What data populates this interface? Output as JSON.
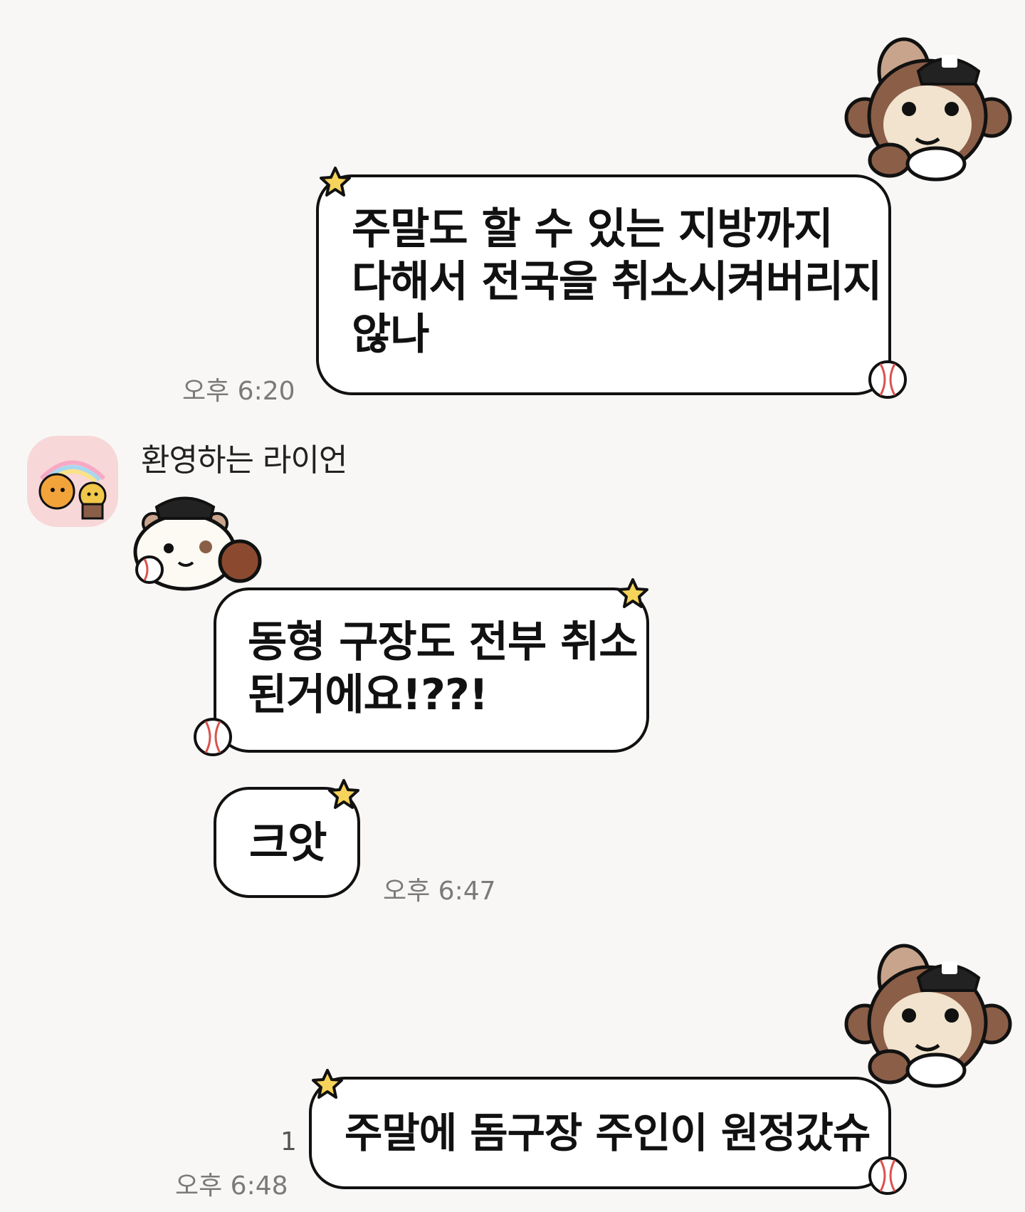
{
  "messages": [
    {
      "direction": "outgoing",
      "text": "주말도 할 수 있는 지방까지\n다해서 전국을 취소시켜버리지\n않나",
      "time": "오후 6:20"
    },
    {
      "direction": "incoming",
      "sender": "환영하는 라이언",
      "text": "동형 구장도 전부 취소\n된거에요!??!"
    },
    {
      "direction": "incoming",
      "text": "크앗",
      "time": "오후 6:47"
    },
    {
      "direction": "outgoing",
      "text": "주말에 돔구장 주인이 원정갔슈",
      "time": "오후 6:48",
      "unread_count": "1"
    }
  ],
  "icons": {
    "sticker_outgoing": "monkey-baseball-sticker",
    "sticker_incoming": "hamster-baseball-sticker",
    "avatar": "ryan-rainbow-avatar",
    "star": "star-icon",
    "ball": "baseball-icon"
  },
  "colors": {
    "background": "#f8f7f5",
    "bubble": "#ffffff",
    "bubble_border": "#111111",
    "time_text": "#7a7a7a",
    "star": "#f6d35a",
    "avatar_bg": "#f7d7d7"
  }
}
